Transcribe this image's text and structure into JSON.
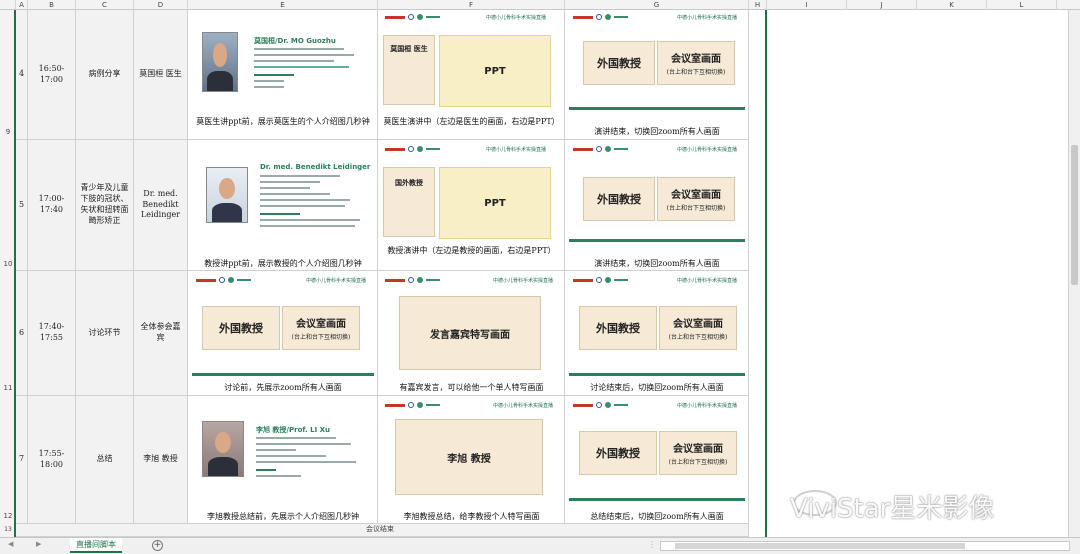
{
  "columns": [
    "A",
    "B",
    "C",
    "D",
    "E",
    "F",
    "G",
    "H",
    "I",
    "J",
    "K",
    "L"
  ],
  "row_numbers": [
    "9",
    "10",
    "11",
    "12",
    "13"
  ],
  "rows": [
    {
      "num": "4",
      "time": "16:50-17:00",
      "topic": "病例分享",
      "speaker": "莫国桓 医生",
      "e_caption": "莫医生讲ppt前，展示莫医生的个人介绍图几秒钟",
      "f_caption": "莫医生演讲中（左边是医生的画面，右边是PPT）",
      "g_caption": "演讲结束，切换回zoom所有人画面",
      "e_name": "莫国桓/Dr. MO Guozhu",
      "f_left": "莫国桓 医生",
      "f_right": "PPT"
    },
    {
      "num": "5",
      "time": "17:00-17:40",
      "topic": "青少年及儿童下肢的冠状、矢状和扭转面畸形矫正",
      "speaker": "Dr. med. Benedikt Leidinger",
      "e_caption": "教授讲ppt前，展示教授的个人介绍图几秒钟",
      "f_caption": "教授演讲中（左边是教授的画面，右边是PPT）",
      "g_caption": "演讲结束，切换回zoom所有人画面",
      "e_name": "Dr. med. Benedikt Leidinger",
      "f_left": "国外教授",
      "f_right": "PPT"
    },
    {
      "num": "6",
      "time": "17:40-17:55",
      "topic": "讨论环节",
      "speaker": "全体参会嘉宾",
      "e_caption": "讨论前，先展示zoom所有人画面",
      "f_caption": "有嘉宾发言，可以给他一个单人特写画面",
      "g_caption": "讨论结束后，切换回zoom所有人画面",
      "f_center": "发言嘉宾特写画面"
    },
    {
      "num": "7",
      "time": "17:55-18:00",
      "topic": "总结",
      "speaker": "李旭 教授",
      "e_caption": "李旭教授总结前，先展示个人介绍图几秒钟",
      "f_caption": "李旭教授总结，给李教授个人特写画面",
      "g_caption": "总结结束后，切换回zoom所有人画面",
      "e_name": "李旭 教授/Prof. LI Xu",
      "f_center": "李旭 教授"
    }
  ],
  "zoom_box": {
    "left": "外国教授",
    "right": "会议室画面",
    "right_sub": "(台上和台下互相切换)"
  },
  "slide_header": "中德小儿骨科手术实操直播",
  "partial_row_text": "会议结束",
  "sheet_tab": "直播间脚本",
  "watermark": "ViviStar星米影像"
}
